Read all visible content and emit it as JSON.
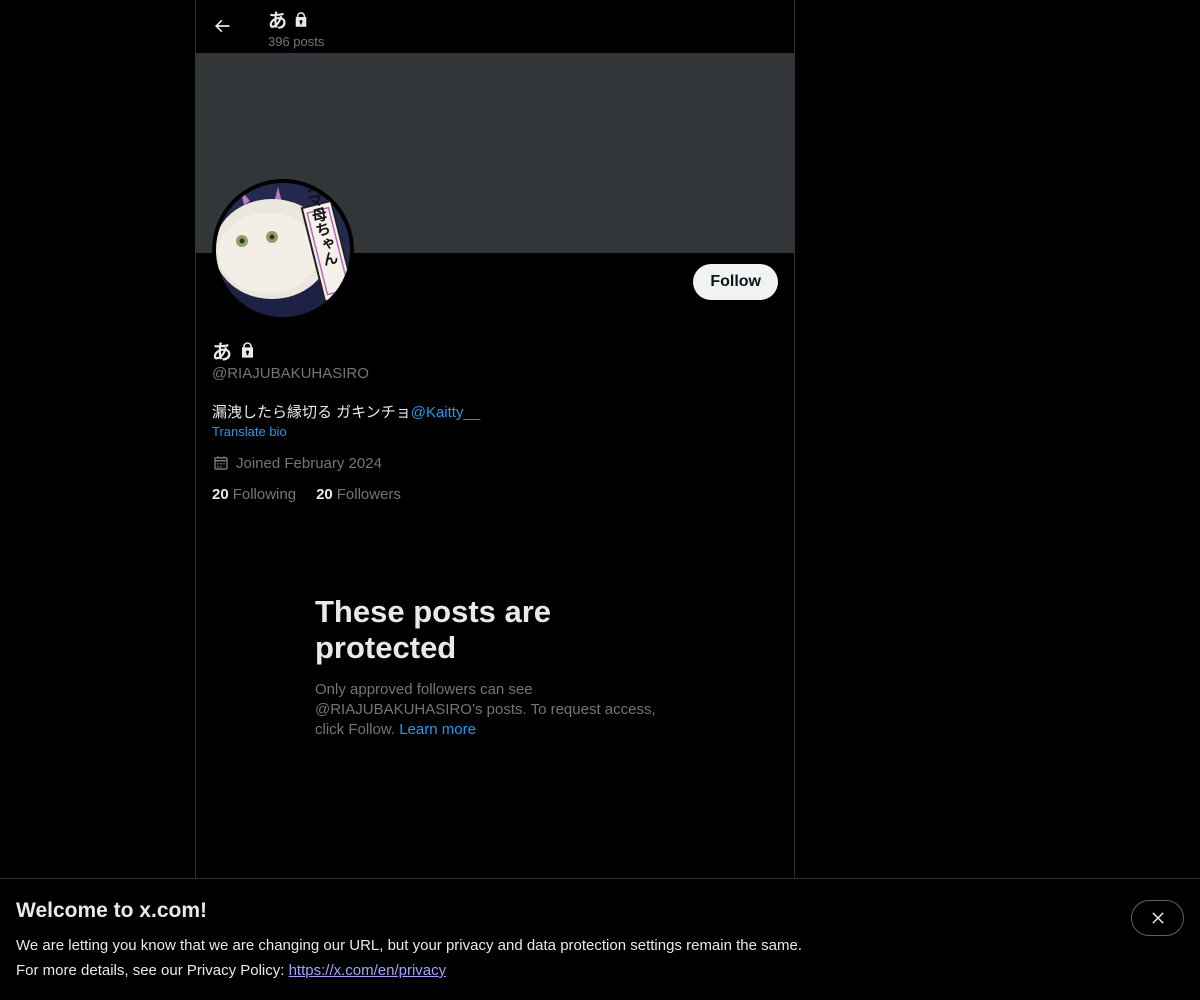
{
  "header": {
    "title": "あ",
    "post_count": "396 posts"
  },
  "profile": {
    "name": "あ",
    "handle": "@RIAJUBAKUHASIRO",
    "bio_text": "漏洩したら縁切る ガキンチョ",
    "bio_mention": "@Kaitty__",
    "translate_label": "Translate bio",
    "joined": "Joined February 2024",
    "following_count": "20",
    "following_label": "Following",
    "followers_count": "20",
    "followers_label": "Followers",
    "follow_button": "Follow",
    "avatar_sign_text": "ゴマ母ちゃん"
  },
  "protected": {
    "title": "These posts are protected",
    "body": "Only approved followers can see @RIAJUBAKUHASIRO’s posts. To request access, click Follow.",
    "learn_more": "Learn more"
  },
  "notice": {
    "title": "Welcome to x.com!",
    "line1": "We are letting you know that we are changing our URL, but your privacy and data protection settings remain the same.",
    "line2_prefix": "For more details, see our Privacy Policy: ",
    "privacy_link": "https://x.com/en/privacy"
  },
  "icons": {
    "back": "arrow-left-icon",
    "lock": "lock-icon",
    "calendar": "calendar-icon",
    "close": "close-icon"
  },
  "colors": {
    "background": "#000000",
    "banner": "#333639",
    "accent": "#1d9bf0",
    "muted_text": "#71767b",
    "link_notice": "#a3a2ff"
  }
}
